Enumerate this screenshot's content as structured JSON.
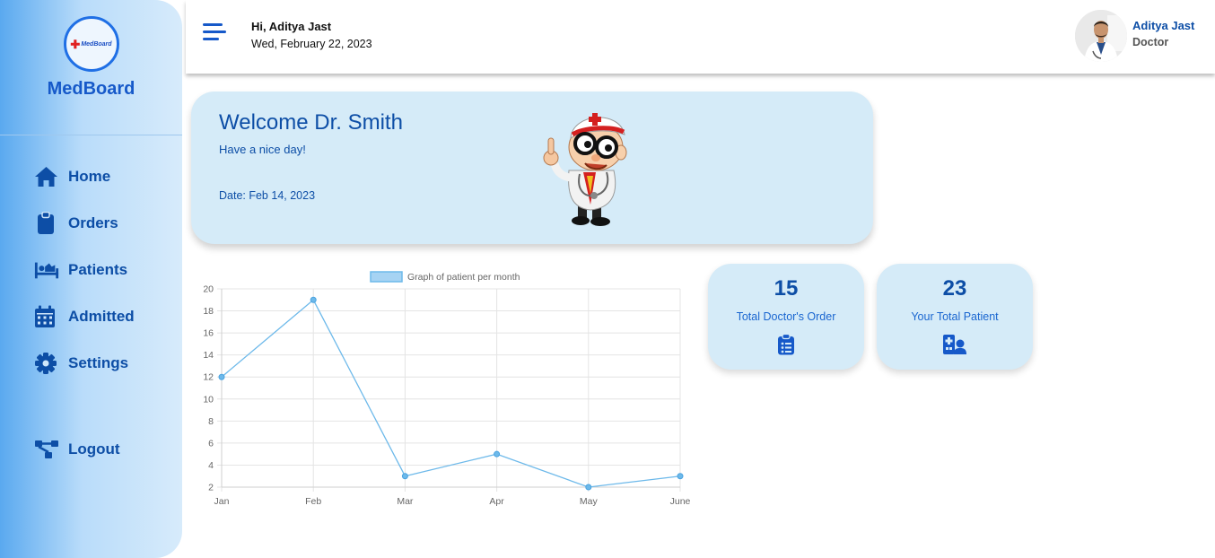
{
  "brand": {
    "logo_text": "MedBoard",
    "name": "MedBoard"
  },
  "sidebar": {
    "items": [
      {
        "label": "Home",
        "icon": "home-icon"
      },
      {
        "label": "Orders",
        "icon": "clipboard-icon"
      },
      {
        "label": "Patients",
        "icon": "bed-icon"
      },
      {
        "label": "Admitted",
        "icon": "calendar-icon"
      },
      {
        "label": "Settings",
        "icon": "gear-icon"
      }
    ],
    "logout": {
      "label": "Logout",
      "icon": "sitemap-icon"
    }
  },
  "header": {
    "greeting": "Hi, Aditya Jast",
    "date": "Wed, February 22, 2023",
    "user_name": "Aditya Jast",
    "user_role": "Doctor"
  },
  "welcome": {
    "title": "Welcome Dr. Smith",
    "subtitle": "Have a nice day!",
    "date": "Date: Feb 14, 2023"
  },
  "chart_data": {
    "type": "line",
    "categories": [
      "Jan",
      "Feb",
      "Mar",
      "Apr",
      "May",
      "June"
    ],
    "series": [
      {
        "name": "Graph of patient per month",
        "values": [
          12,
          19,
          3,
          5,
          2,
          3
        ]
      }
    ],
    "ylim": [
      2,
      20
    ],
    "yticks": [
      2,
      4,
      6,
      8,
      10,
      12,
      14,
      16,
      18,
      20
    ],
    "grid": true,
    "legend": "top-center",
    "color": "#6db9ea"
  },
  "stats": [
    {
      "value": "15",
      "label": "Total Doctor's Order",
      "icon": "clipboard-list-icon"
    },
    {
      "value": "23",
      "label": "Your Total Patient",
      "icon": "hospital-user-icon"
    }
  ],
  "colors": {
    "primary": "#0d4ea6",
    "accent": "#1659c9",
    "card": "#d5ebf8"
  }
}
